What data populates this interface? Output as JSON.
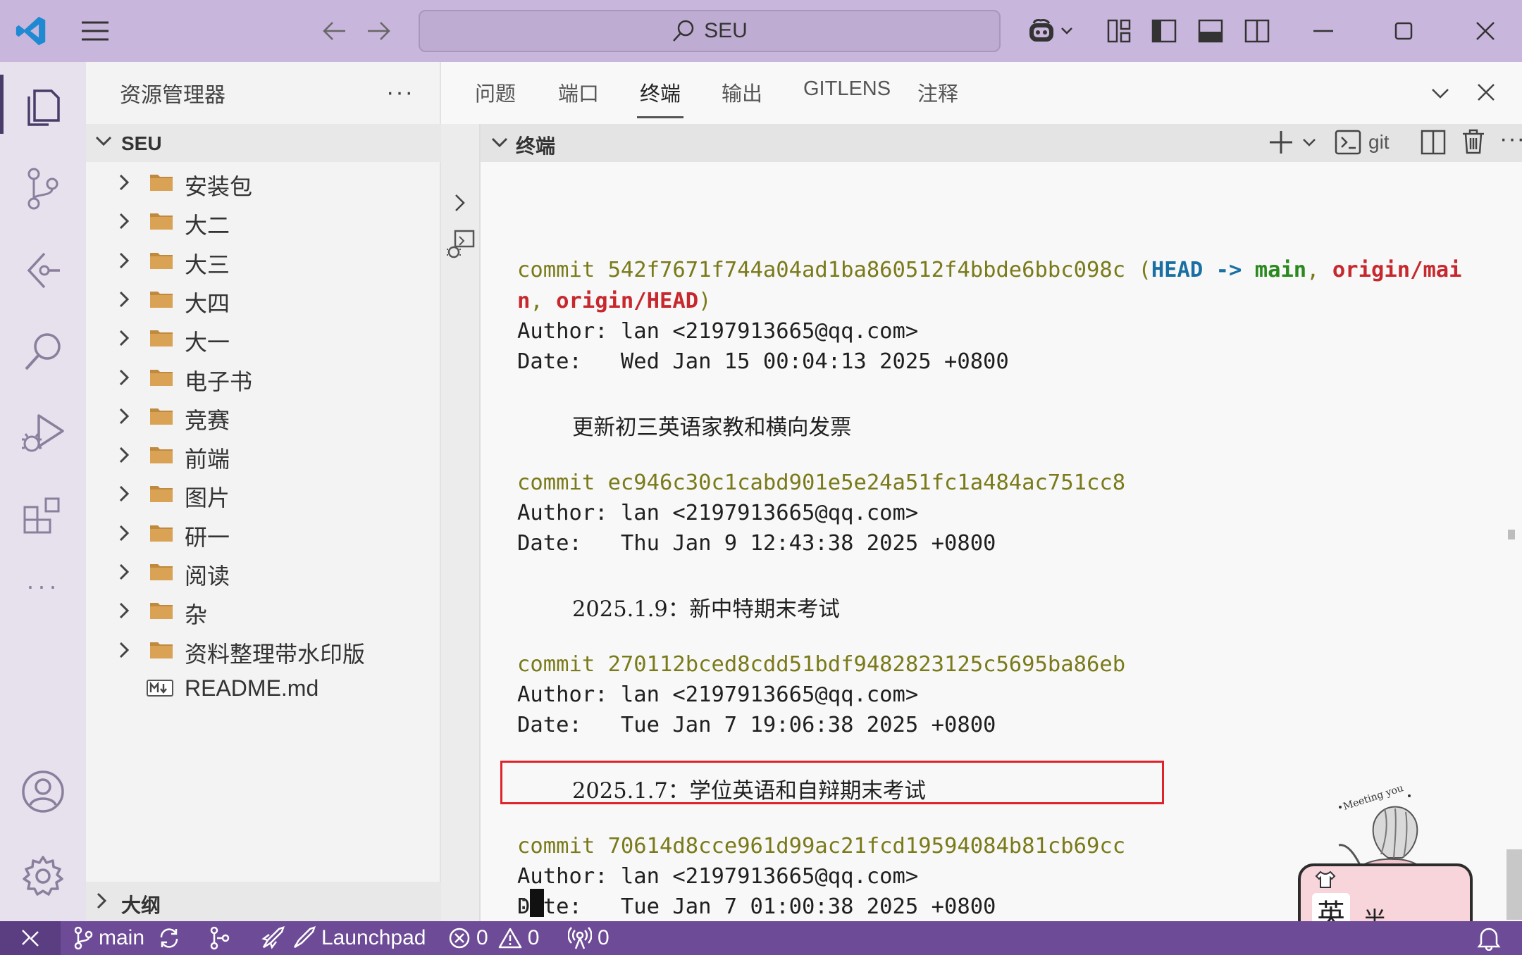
{
  "titlebar": {
    "search_text": "SEU",
    "icons": [
      "vscode-logo",
      "menu-icon",
      "back-arrow-icon",
      "forward-arrow-icon",
      "copilot-icon",
      "customize-layout-icon",
      "toggle-sidebar-icon",
      "toggle-panel-icon",
      "toggle-secondary-sidebar-icon",
      "minimize-icon",
      "maximize-icon",
      "close-icon"
    ]
  },
  "activitybar": {
    "items": [
      "explorer",
      "source-control",
      "gitlens",
      "search",
      "run-debug",
      "extensions",
      "more",
      "accounts",
      "settings"
    ],
    "more_label": "···"
  },
  "sidebar": {
    "title": "资源管理器",
    "more_label": "···",
    "folder": "SEU",
    "items": [
      {
        "label": "安装包",
        "type": "folder"
      },
      {
        "label": "大二",
        "type": "folder"
      },
      {
        "label": "大三",
        "type": "folder"
      },
      {
        "label": "大四",
        "type": "folder"
      },
      {
        "label": "大一",
        "type": "folder"
      },
      {
        "label": "电子书",
        "type": "folder"
      },
      {
        "label": "竞赛",
        "type": "folder"
      },
      {
        "label": "前端",
        "type": "folder"
      },
      {
        "label": "图片",
        "type": "folder"
      },
      {
        "label": "研一",
        "type": "folder"
      },
      {
        "label": "阅读",
        "type": "folder"
      },
      {
        "label": "杂",
        "type": "folder"
      },
      {
        "label": "资料整理带水印版",
        "type": "folder"
      },
      {
        "label": "README.md",
        "type": "markdown"
      }
    ],
    "outline": "大纲"
  },
  "panel": {
    "tabs": [
      "问题",
      "端口",
      "终端",
      "输出",
      "GITLENS",
      "注释"
    ],
    "active_tab": "终端",
    "terminal_title": "终端",
    "terminal_profile": "git"
  },
  "terminal": {
    "commits": [
      {
        "commit_label": "commit",
        "hash": "542f7671f744a04ad1ba860512f4bbde6bbc098c",
        "refs_open": " (",
        "head": "HEAD -> ",
        "main": "main",
        "sep": ", ",
        "origin_main_a": "origin/mai",
        "origin_main_b": "n",
        "origin_head": "origin/HEAD",
        "refs_close": ")",
        "author": "Author: lan <2197913665@qq.com>",
        "date": "Date:   Wed Jan 15 00:04:13 2025 +0800",
        "message": "更新初三英语家教和横向发票"
      },
      {
        "commit_label": "commit",
        "hash": "ec946c30c1cabd901e5e24a51fc1a484ac751cc8",
        "author": "Author: lan <2197913665@qq.com>",
        "date": "Date:   Thu Jan 9 12:43:38 2025 +0800",
        "message": "2025.1.9：新中特期末考试"
      },
      {
        "commit_label": "commit",
        "hash": "270112bced8cdd51bdf9482823125c5695ba86eb",
        "author": "Author: lan <2197913665@qq.com>",
        "date": "Date:   Tue Jan 7 19:06:38 2025 +0800",
        "message": "2025.1.7：学位英语和自辩期末考试"
      },
      {
        "commit_label": "commit",
        "hash": "70614d8cce961d99ac21fcd19594084b81cb69cc",
        "author": "Author: lan <2197913665@qq.com>",
        "date": "Date:   Tue Jan 7 01:00:38 2025 +0800",
        "highlighted": true
      }
    ],
    "prompt": ":"
  },
  "statusbar": {
    "branch": "main",
    "launchpad": "Launchpad",
    "errors": "0",
    "warnings": "0",
    "ports": "0"
  },
  "sticker": {
    "caption": "Meeting you",
    "ime_lang": "英",
    "ime_width": "半"
  },
  "colors": {
    "titlebar": "#c9b6dc",
    "statusbar": "#6d4b97",
    "commit_hash": "#7a7a1a",
    "head_ref": "#1a6fa3",
    "branch_ref": "#2b8a1f",
    "remote_ref": "#c7282d",
    "highlight": "#e0232b"
  }
}
